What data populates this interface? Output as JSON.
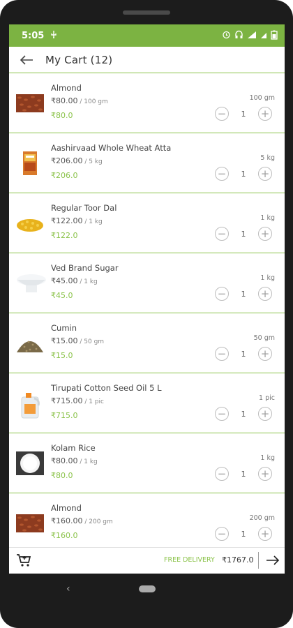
{
  "status": {
    "time": "5:05"
  },
  "header": {
    "title": "My Cart (12)"
  },
  "items": [
    {
      "name": "Almond",
      "price": "₹80.00",
      "unit": " / 100 gm",
      "sale_price": "₹80.0",
      "qty_label": "100 gm",
      "quantity": "1",
      "image": "almond-image"
    },
    {
      "name": "Aashirvaad Whole Wheat Atta",
      "price": "₹206.00",
      "unit": " / 5 kg",
      "sale_price": "₹206.0",
      "qty_label": "5 kg",
      "quantity": "1",
      "image": "atta-bag-image"
    },
    {
      "name": "Regular Toor Dal",
      "price": "₹122.00",
      "unit": " / 1 kg",
      "sale_price": "₹122.0",
      "qty_label": "1 kg",
      "quantity": "1",
      "image": "toor-dal-image"
    },
    {
      "name": "Ved Brand Sugar",
      "price": "₹45.00",
      "unit": " / 1 kg",
      "sale_price": "₹45.0",
      "qty_label": "1 kg",
      "quantity": "1",
      "image": "sugar-image"
    },
    {
      "name": "Cumin",
      "price": "₹15.00",
      "unit": " / 50 gm",
      "sale_price": "₹15.0",
      "qty_label": "50 gm",
      "quantity": "1",
      "image": "cumin-image"
    },
    {
      "name": "Tirupati Cotton Seed Oil 5 L",
      "price": "₹715.00",
      "unit": " / 1 pic",
      "sale_price": "₹715.0",
      "qty_label": "1 pic",
      "quantity": "1",
      "image": "oil-can-image"
    },
    {
      "name": "Kolam Rice",
      "price": "₹80.00",
      "unit": " / 1 kg",
      "sale_price": "₹80.0",
      "qty_label": "1 kg",
      "quantity": "1",
      "image": "rice-image"
    },
    {
      "name": "Almond",
      "price": "₹160.00",
      "unit": " / 200 gm",
      "sale_price": "₹160.0",
      "qty_label": "200 gm",
      "quantity": "1",
      "image": "almond-image"
    }
  ],
  "stepper": {
    "minus": "−",
    "plus": "+"
  },
  "footer": {
    "delivery": "FREE DELIVERY",
    "total": "₹1767.0"
  },
  "icons": {
    "back": "arrow-left-icon",
    "cart": "cart-icon",
    "next": "arrow-right-icon"
  },
  "colors": {
    "accent": "#7cb342",
    "sale": "#8bc34a"
  }
}
